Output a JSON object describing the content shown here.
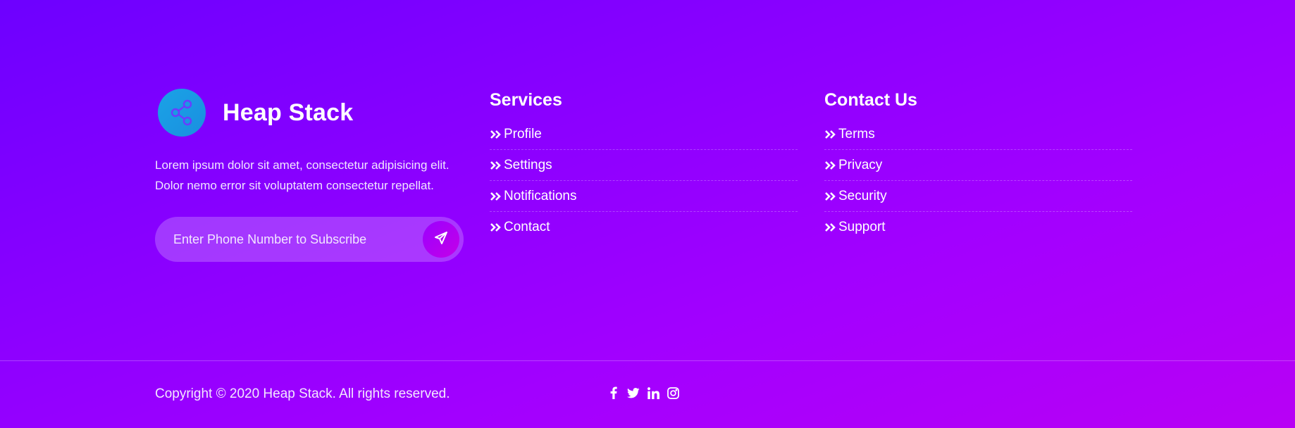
{
  "brand": {
    "name": "Heap Stack",
    "logo_icon": "share-icon",
    "description": "Lorem ipsum dolor sit amet, consectetur adipisicing elit. Dolor nemo error sit voluptatem consectetur repellat."
  },
  "subscribe": {
    "placeholder": "Enter Phone Number to Subscribe",
    "value": "",
    "button_icon": "paper-plane-icon"
  },
  "services": {
    "title": "Services",
    "items": [
      {
        "label": "Profile",
        "icon": "double-chevron-right-icon"
      },
      {
        "label": "Settings",
        "icon": "double-chevron-right-icon"
      },
      {
        "label": "Notifications",
        "icon": "double-chevron-right-icon"
      },
      {
        "label": "Contact",
        "icon": "double-chevron-right-icon"
      }
    ]
  },
  "contact": {
    "title": "Contact Us",
    "items": [
      {
        "label": "Terms",
        "icon": "double-chevron-right-icon"
      },
      {
        "label": "Privacy",
        "icon": "double-chevron-right-icon"
      },
      {
        "label": "Security",
        "icon": "double-chevron-right-icon"
      },
      {
        "label": "Support",
        "icon": "double-chevron-right-icon"
      }
    ]
  },
  "footer": {
    "copyright": "Copyright © 2020 Heap Stack. All rights reserved.",
    "social": [
      "facebook-icon",
      "twitter-icon",
      "linkedin-icon",
      "instagram-icon"
    ]
  },
  "colors": {
    "background_start": "#6d00ff",
    "background_end": "#b800f5",
    "logo_circle": "#19a3e6",
    "text": "#ffffff"
  }
}
